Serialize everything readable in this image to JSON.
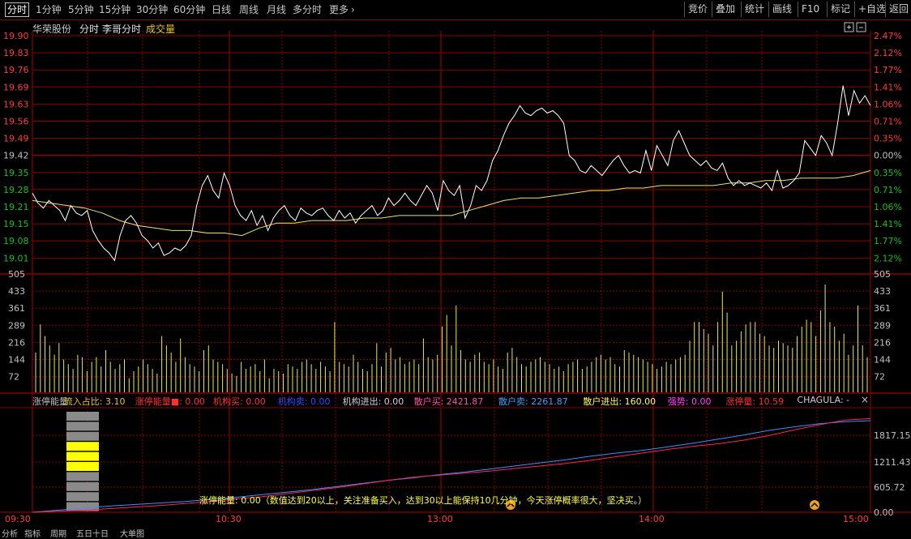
{
  "tabs": {
    "left": [
      "分时",
      "1分钟",
      "5分钟",
      "15分钟",
      "30分钟",
      "60分钟",
      "日线",
      "周线",
      "月线",
      "多分时",
      "更多"
    ],
    "more_arrow": "›",
    "right": [
      "竞价",
      "叠加",
      "统计",
      "画线",
      "F10",
      "标记",
      "+自选",
      "返回"
    ]
  },
  "header": {
    "stock": "华荣股份",
    "mode": "分时",
    "indicator": "李哥分时",
    "volume_label": "成交量"
  },
  "header_icons": [
    "plus-circle-icon",
    "minimize-icon"
  ],
  "price_axis": {
    "left": [
      "19.90",
      "19.83",
      "19.76",
      "19.69",
      "19.63",
      "19.56",
      "19.49",
      "19.42",
      "19.35",
      "19.28",
      "19.21",
      "19.15",
      "19.08",
      "19.01"
    ],
    "right": [
      "2.47%",
      "2.12%",
      "1.77%",
      "1.41%",
      "1.06%",
      "0.71%",
      "0.35%",
      "0.00%",
      "0.35%",
      "0.71%",
      "1.06%",
      "1.41%",
      "1.77%",
      "2.12%"
    ]
  },
  "volume_axis": [
    "505",
    "433",
    "361",
    "289",
    "216",
    "144",
    "72"
  ],
  "indicator_bar": {
    "items": [
      {
        "text": "涨停能量",
        "color": "#c0c0c0"
      },
      {
        "text": "流入占比: 3.10",
        "color": "#e7c41c"
      },
      {
        "text": "涨停能量■: 0.00",
        "color": "#ff3030"
      },
      {
        "text": "机构买: 0.00",
        "color": "#ff3030"
      },
      {
        "text": "机构卖: 0.00",
        "color": "#2c4bff"
      },
      {
        "text": "机构进出: 0.00",
        "color": "#d0d0d0"
      },
      {
        "text": "散户买: 2421.87",
        "color": "#ff4fa3"
      },
      {
        "text": "散户卖: 2261.87",
        "color": "#3aa0ff"
      },
      {
        "text": "散户进出: 160.00",
        "color": "#ffff40"
      },
      {
        "text": "强势: 0.00",
        "color": "#ff40ff"
      },
      {
        "text": "涨停量: 10.59",
        "color": "#ff3030"
      },
      {
        "text": "CHAGULA: -",
        "color": "#d0d0d0"
      }
    ],
    "close": "×"
  },
  "lower_axis": [
    "1817.15",
    "1211.43",
    "605.72",
    "0.00"
  ],
  "note": "涨停能量: 0.00（数值达到20以上，关注准备买入，达到30以上能保持10几分钟，今天涨停概率很大，坚决买。）",
  "time_axis": [
    "09:30",
    "10:30",
    "13:00",
    "14:00",
    "15:00"
  ],
  "bottom_tabs": [
    "分析",
    "指标",
    "周期",
    "五日十日",
    "大单图"
  ],
  "colors": {
    "grid": "#8b0000",
    "price_line": "#ffffff",
    "avg_line": "#e8e85a",
    "volume": "#e8e85a",
    "up": "#ff3b3b",
    "down": "#18c018",
    "flat": "#c0c0c0",
    "lower_red": "#ff2060",
    "lower_blue": "#3a90ff"
  },
  "chart_data": {
    "type": "line",
    "title": "",
    "xlabel": "",
    "ylabel": "",
    "x_ticks": [
      "09:30",
      "10:30",
      "13:00",
      "14:00",
      "15:00"
    ],
    "prev_close": 19.42,
    "ylim": [
      18.94,
      19.9
    ],
    "series": [
      {
        "values": [
          19.27,
          19.23,
          19.21,
          19.24,
          19.22,
          19.2,
          19.16,
          19.22,
          19.19,
          19.18,
          19.2,
          19.12,
          19.08,
          19.05,
          19.03,
          19.0,
          19.1,
          19.16,
          19.18,
          19.15,
          19.1,
          19.08,
          19.05,
          19.07,
          19.02,
          19.03,
          19.05,
          19.04,
          19.06,
          19.1,
          19.22,
          19.3,
          19.34,
          19.28,
          19.25,
          19.35,
          19.3,
          19.22,
          19.18,
          19.16,
          19.2,
          19.14,
          19.18,
          19.12,
          19.17,
          19.2,
          19.22,
          19.18,
          19.16,
          19.21,
          19.19,
          19.18,
          19.2,
          19.21,
          19.18,
          19.16,
          19.2,
          19.17,
          19.19,
          19.15,
          19.18,
          19.2,
          19.22,
          19.18,
          19.2,
          19.25,
          19.22,
          19.24,
          19.27,
          19.24,
          19.22,
          19.26,
          19.3,
          19.27,
          19.2,
          19.32,
          19.28,
          19.26,
          19.3,
          19.17,
          19.22,
          19.3,
          19.28,
          19.32,
          19.4,
          19.44,
          19.5,
          19.55,
          19.58,
          19.62,
          19.59,
          19.58,
          19.6,
          19.61,
          19.59,
          19.6,
          19.58,
          19.55,
          19.42,
          19.4,
          19.36,
          19.35,
          19.38,
          19.36,
          19.34,
          19.37,
          19.4,
          19.42,
          19.38,
          19.35,
          19.36,
          19.35,
          19.44,
          19.36,
          19.46,
          19.42,
          19.38,
          19.48,
          19.52,
          19.47,
          19.42,
          19.4,
          19.38,
          19.4,
          19.37,
          19.36,
          19.39,
          19.33,
          19.3,
          19.32,
          19.3,
          19.31,
          19.3,
          19.29,
          19.31,
          19.28,
          19.36,
          19.29,
          19.3,
          19.32,
          19.35,
          19.48,
          19.45,
          19.42,
          19.5,
          19.47,
          19.42,
          19.55,
          19.7,
          19.58,
          19.68,
          19.63,
          19.66,
          19.62
        ]
      },
      {
        "values": [
          19.24,
          19.23,
          19.22,
          19.21,
          19.19,
          19.16,
          19.14,
          19.13,
          19.12,
          19.12,
          19.11,
          19.11,
          19.1,
          19.13,
          19.15,
          19.15,
          19.16,
          19.16,
          19.16,
          19.17,
          19.17,
          19.18,
          19.18,
          19.18,
          19.18,
          19.2,
          19.22,
          19.24,
          19.25,
          19.25,
          19.26,
          19.27,
          19.28,
          19.28,
          19.29,
          19.29,
          19.3,
          19.3,
          19.3,
          19.3,
          19.31,
          19.31,
          19.32,
          19.32,
          19.33,
          19.33,
          19.33,
          19.34,
          19.36
        ]
      }
    ],
    "volume": [
      170,
      290,
      240,
      200,
      160,
      210,
      140,
      120,
      100,
      160,
      150,
      90,
      130,
      150,
      110,
      180,
      130,
      100,
      120,
      140,
      60,
      90,
      110,
      140,
      120,
      100,
      80,
      240,
      200,
      170,
      130,
      230,
      150,
      120,
      110,
      90,
      180,
      200,
      140,
      130,
      120,
      100,
      80,
      70,
      130,
      100,
      110,
      120,
      90,
      140,
      60,
      100,
      90,
      80,
      120,
      110,
      100,
      130,
      140,
      120,
      100,
      130,
      110,
      90,
      300,
      130,
      120,
      110,
      160,
      130,
      100,
      90,
      120,
      210,
      110,
      170,
      190,
      140,
      150,
      120,
      130,
      140,
      120,
      230,
      150,
      140,
      160,
      280,
      330,
      200,
      370,
      180,
      140,
      130,
      160,
      170,
      130,
      120,
      140,
      110,
      100,
      170,
      190,
      150,
      120,
      110,
      130,
      140,
      150,
      130,
      120,
      100,
      110,
      90,
      120,
      130,
      140,
      100,
      110,
      130,
      150,
      160,
      140,
      150,
      120,
      110,
      180,
      170,
      160,
      150,
      140,
      130,
      120,
      100,
      110,
      130,
      120,
      140,
      150,
      160,
      220,
      300,
      300,
      270,
      250,
      200,
      300,
      430,
      340,
      200,
      220,
      260,
      290,
      300,
      300,
      250,
      240,
      200,
      190,
      220,
      210,
      200,
      190,
      240,
      280,
      310,
      300,
      240,
      350,
      460,
      300,
      280,
      220,
      250,
      160,
      200,
      370,
      200,
      150
    ],
    "lower": {
      "retail_buy": [
        0,
        20,
        40,
        70,
        100,
        130,
        170,
        210,
        260,
        300,
        360,
        420,
        480,
        550,
        620,
        680,
        720,
        760,
        800,
        850,
        900,
        950,
        1010,
        1080,
        1150,
        1220,
        1280,
        1330,
        1400,
        1490,
        1600,
        1700,
        1790,
        1820
      ],
      "retail_sell": [
        0,
        40,
        80,
        120,
        150,
        180,
        210,
        250,
        290,
        340,
        390,
        440,
        500,
        560,
        620,
        670,
        730,
        780,
        840,
        900,
        960,
        1020,
        1090,
        1150,
        1200,
        1270,
        1340,
        1420,
        1500,
        1590,
        1660,
        1720,
        1760,
        1780
      ]
    }
  }
}
